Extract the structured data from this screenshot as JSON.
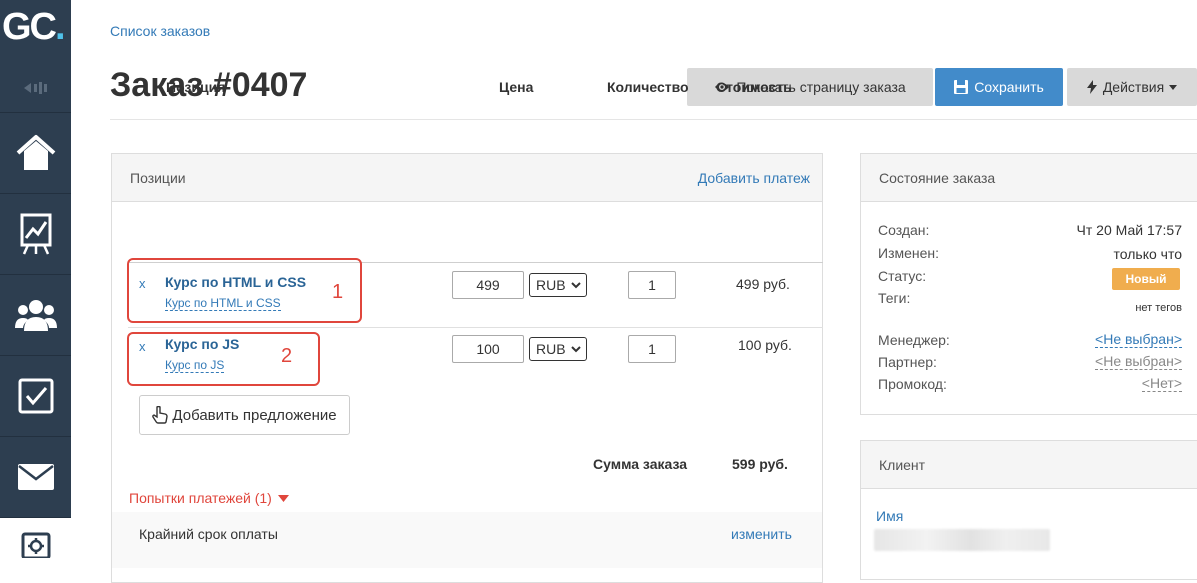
{
  "brand": {
    "logo_text": "GC",
    "logo_dot": "."
  },
  "sidebar": {
    "items": [
      {
        "icon": "home-icon"
      },
      {
        "icon": "chart-icon"
      },
      {
        "icon": "users-icon"
      },
      {
        "icon": "checkbox-icon"
      },
      {
        "icon": "mail-icon"
      },
      {
        "icon": "settings-icon"
      }
    ]
  },
  "breadcrumb": "Список заказов",
  "page_title": "Заказ #0407",
  "toolbar": {
    "show_page": "Показать страницу заказа",
    "save": "Сохранить",
    "actions": "Действия"
  },
  "positions_panel": {
    "title": "Позиции",
    "add_payment": "Добавить платеж",
    "columns": [
      "Позиция",
      "Цена",
      "Количество",
      "Стоимость"
    ],
    "rows": [
      {
        "remove": "x",
        "title": "Курс по HTML и CSS",
        "subtitle": "Курс по HTML и CSS",
        "price": "499",
        "currency": "RUB",
        "qty": "1",
        "total": "499 руб.",
        "marker": "1"
      },
      {
        "remove": "x",
        "title": "Курс по JS",
        "subtitle": "Курс по JS",
        "price": "100",
        "currency": "RUB",
        "qty": "1",
        "total": "100 руб.",
        "marker": "2"
      }
    ],
    "add_offer": "Добавить предложение",
    "sum_label": "Сумма заказа",
    "sum_value": "599 руб.",
    "payment_attempts": "Попытки платежей (1)",
    "deadline_label": "Крайний срок оплаты",
    "deadline_edit": "изменить"
  },
  "state_panel": {
    "title": "Состояние заказа",
    "created_label": "Создан:",
    "created_value": "Чт 20 Май 17:57",
    "changed_label": "Изменен:",
    "changed_value": "только что",
    "status_label": "Статус:",
    "status_value": "Новый",
    "tags_label": "Теги:",
    "tags_value": "нет тегов",
    "manager_label": "Менеджер:",
    "manager_value": "<Не выбран>",
    "partner_label": "Партнер:",
    "partner_value": "<Не выбран>",
    "promo_label": "Промокод:",
    "promo_value": "<Нет>"
  },
  "client_panel": {
    "title": "Клиент",
    "name_label": "Имя"
  },
  "colors": {
    "sidebar": "#2d3e50",
    "link": "#337ab7",
    "primary": "#428bca",
    "warning": "#f0ad4e",
    "danger": "#e0463c"
  }
}
